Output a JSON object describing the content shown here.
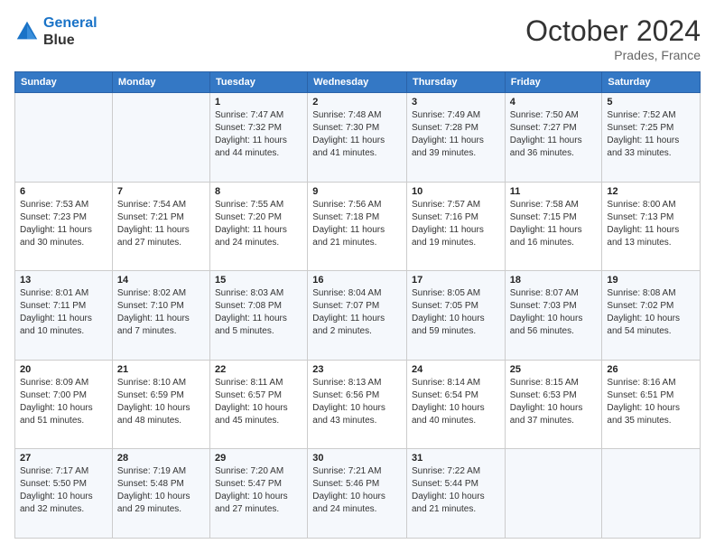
{
  "header": {
    "logo_line1": "General",
    "logo_line2": "Blue",
    "month": "October 2024",
    "location": "Prades, France"
  },
  "days_of_week": [
    "Sunday",
    "Monday",
    "Tuesday",
    "Wednesday",
    "Thursday",
    "Friday",
    "Saturday"
  ],
  "weeks": [
    [
      {
        "day": "",
        "sunrise": "",
        "sunset": "",
        "daylight": ""
      },
      {
        "day": "",
        "sunrise": "",
        "sunset": "",
        "daylight": ""
      },
      {
        "day": "1",
        "sunrise": "Sunrise: 7:47 AM",
        "sunset": "Sunset: 7:32 PM",
        "daylight": "Daylight: 11 hours and 44 minutes."
      },
      {
        "day": "2",
        "sunrise": "Sunrise: 7:48 AM",
        "sunset": "Sunset: 7:30 PM",
        "daylight": "Daylight: 11 hours and 41 minutes."
      },
      {
        "day": "3",
        "sunrise": "Sunrise: 7:49 AM",
        "sunset": "Sunset: 7:28 PM",
        "daylight": "Daylight: 11 hours and 39 minutes."
      },
      {
        "day": "4",
        "sunrise": "Sunrise: 7:50 AM",
        "sunset": "Sunset: 7:27 PM",
        "daylight": "Daylight: 11 hours and 36 minutes."
      },
      {
        "day": "5",
        "sunrise": "Sunrise: 7:52 AM",
        "sunset": "Sunset: 7:25 PM",
        "daylight": "Daylight: 11 hours and 33 minutes."
      }
    ],
    [
      {
        "day": "6",
        "sunrise": "Sunrise: 7:53 AM",
        "sunset": "Sunset: 7:23 PM",
        "daylight": "Daylight: 11 hours and 30 minutes."
      },
      {
        "day": "7",
        "sunrise": "Sunrise: 7:54 AM",
        "sunset": "Sunset: 7:21 PM",
        "daylight": "Daylight: 11 hours and 27 minutes."
      },
      {
        "day": "8",
        "sunrise": "Sunrise: 7:55 AM",
        "sunset": "Sunset: 7:20 PM",
        "daylight": "Daylight: 11 hours and 24 minutes."
      },
      {
        "day": "9",
        "sunrise": "Sunrise: 7:56 AM",
        "sunset": "Sunset: 7:18 PM",
        "daylight": "Daylight: 11 hours and 21 minutes."
      },
      {
        "day": "10",
        "sunrise": "Sunrise: 7:57 AM",
        "sunset": "Sunset: 7:16 PM",
        "daylight": "Daylight: 11 hours and 19 minutes."
      },
      {
        "day": "11",
        "sunrise": "Sunrise: 7:58 AM",
        "sunset": "Sunset: 7:15 PM",
        "daylight": "Daylight: 11 hours and 16 minutes."
      },
      {
        "day": "12",
        "sunrise": "Sunrise: 8:00 AM",
        "sunset": "Sunset: 7:13 PM",
        "daylight": "Daylight: 11 hours and 13 minutes."
      }
    ],
    [
      {
        "day": "13",
        "sunrise": "Sunrise: 8:01 AM",
        "sunset": "Sunset: 7:11 PM",
        "daylight": "Daylight: 11 hours and 10 minutes."
      },
      {
        "day": "14",
        "sunrise": "Sunrise: 8:02 AM",
        "sunset": "Sunset: 7:10 PM",
        "daylight": "Daylight: 11 hours and 7 minutes."
      },
      {
        "day": "15",
        "sunrise": "Sunrise: 8:03 AM",
        "sunset": "Sunset: 7:08 PM",
        "daylight": "Daylight: 11 hours and 5 minutes."
      },
      {
        "day": "16",
        "sunrise": "Sunrise: 8:04 AM",
        "sunset": "Sunset: 7:07 PM",
        "daylight": "Daylight: 11 hours and 2 minutes."
      },
      {
        "day": "17",
        "sunrise": "Sunrise: 8:05 AM",
        "sunset": "Sunset: 7:05 PM",
        "daylight": "Daylight: 10 hours and 59 minutes."
      },
      {
        "day": "18",
        "sunrise": "Sunrise: 8:07 AM",
        "sunset": "Sunset: 7:03 PM",
        "daylight": "Daylight: 10 hours and 56 minutes."
      },
      {
        "day": "19",
        "sunrise": "Sunrise: 8:08 AM",
        "sunset": "Sunset: 7:02 PM",
        "daylight": "Daylight: 10 hours and 54 minutes."
      }
    ],
    [
      {
        "day": "20",
        "sunrise": "Sunrise: 8:09 AM",
        "sunset": "Sunset: 7:00 PM",
        "daylight": "Daylight: 10 hours and 51 minutes."
      },
      {
        "day": "21",
        "sunrise": "Sunrise: 8:10 AM",
        "sunset": "Sunset: 6:59 PM",
        "daylight": "Daylight: 10 hours and 48 minutes."
      },
      {
        "day": "22",
        "sunrise": "Sunrise: 8:11 AM",
        "sunset": "Sunset: 6:57 PM",
        "daylight": "Daylight: 10 hours and 45 minutes."
      },
      {
        "day": "23",
        "sunrise": "Sunrise: 8:13 AM",
        "sunset": "Sunset: 6:56 PM",
        "daylight": "Daylight: 10 hours and 43 minutes."
      },
      {
        "day": "24",
        "sunrise": "Sunrise: 8:14 AM",
        "sunset": "Sunset: 6:54 PM",
        "daylight": "Daylight: 10 hours and 40 minutes."
      },
      {
        "day": "25",
        "sunrise": "Sunrise: 8:15 AM",
        "sunset": "Sunset: 6:53 PM",
        "daylight": "Daylight: 10 hours and 37 minutes."
      },
      {
        "day": "26",
        "sunrise": "Sunrise: 8:16 AM",
        "sunset": "Sunset: 6:51 PM",
        "daylight": "Daylight: 10 hours and 35 minutes."
      }
    ],
    [
      {
        "day": "27",
        "sunrise": "Sunrise: 7:17 AM",
        "sunset": "Sunset: 5:50 PM",
        "daylight": "Daylight: 10 hours and 32 minutes."
      },
      {
        "day": "28",
        "sunrise": "Sunrise: 7:19 AM",
        "sunset": "Sunset: 5:48 PM",
        "daylight": "Daylight: 10 hours and 29 minutes."
      },
      {
        "day": "29",
        "sunrise": "Sunrise: 7:20 AM",
        "sunset": "Sunset: 5:47 PM",
        "daylight": "Daylight: 10 hours and 27 minutes."
      },
      {
        "day": "30",
        "sunrise": "Sunrise: 7:21 AM",
        "sunset": "Sunset: 5:46 PM",
        "daylight": "Daylight: 10 hours and 24 minutes."
      },
      {
        "day": "31",
        "sunrise": "Sunrise: 7:22 AM",
        "sunset": "Sunset: 5:44 PM",
        "daylight": "Daylight: 10 hours and 21 minutes."
      },
      {
        "day": "",
        "sunrise": "",
        "sunset": "",
        "daylight": ""
      },
      {
        "day": "",
        "sunrise": "",
        "sunset": "",
        "daylight": ""
      }
    ]
  ]
}
